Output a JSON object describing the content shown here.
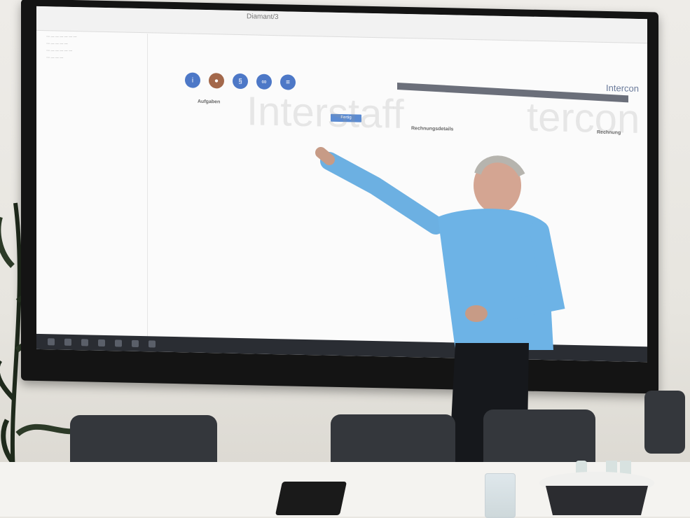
{
  "screen": {
    "app_title": "Diamant/3",
    "brand": "Intercon",
    "tag": "Fertig",
    "sections": {
      "aufgaben": "Aufgaben",
      "rechnungsdetails": "Rechnungsdetails",
      "rechnung": "Rechnung"
    },
    "watermark_left": "Interstaff",
    "watermark_right": "tercon"
  }
}
